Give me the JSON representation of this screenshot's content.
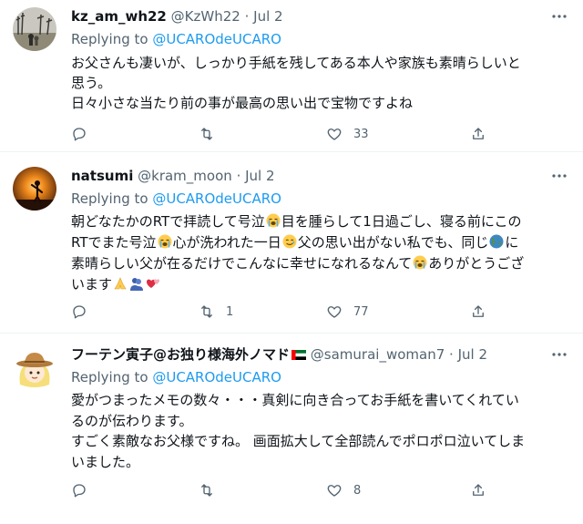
{
  "tweets": [
    {
      "name": "kz_am_wh22",
      "handle": "@KzWh22",
      "dot": "·",
      "date": "Jul 2",
      "replying_prefix": "Replying to ",
      "replying_to": "@UCAROdeUCARO",
      "lines": [
        "お父さんも凄いが、しっかり手紙を残してある本人や家族も素晴らしいと",
        "思う。",
        "日々小さな当たり前の事が最高の思い出で宝物ですよね"
      ],
      "replies": "",
      "retweets": "",
      "likes": "33",
      "avatar": "photo-trees-park"
    },
    {
      "name": "natsumi",
      "handle": "@kram_moon",
      "dot": "·",
      "date": "Jul 2",
      "replying_prefix": "Replying to ",
      "replying_to": "@UCAROdeUCARO",
      "segments": {
        "l1a": "朝どなたかのRTで拝読して号泣",
        "l1b": "目を腫らして1日過ごし、寝る前にこの",
        "l2a": "RTでまた号泣",
        "l2b": "心が洗われた一日",
        "l2c": "父の思い出がない私でも、同じ",
        "l2d": "に",
        "l3a": "素晴らしい父が在るだけでこんなに幸せになれるなんて",
        "l3b": "ありがとうござ",
        "l4a": "います"
      },
      "emoji": {
        "crying": "loudly-crying-face",
        "smiling_tear": "smiling-face-with-tear",
        "globe": "globe-icon",
        "pray": "folded-hands",
        "hug": "people-hugging",
        "hearts": "revolving-hearts"
      },
      "replies": "",
      "retweets": "1",
      "likes": "77",
      "avatar": "photo-sunset-silhouette"
    },
    {
      "name": "フーテン寅子@お独り様海外ノマド",
      "handle": "@samurai_woman7",
      "dot": "·",
      "date": "Jul 2",
      "flag": "uae-flag",
      "replying_prefix": "Replying to ",
      "replying_to": "@UCAROdeUCARO",
      "lines": [
        "愛がつまったメモの数々・・・真剣に向き合ってお手紙を書いてくれてい",
        "るのが伝わります。",
        "すごく素敵なお父様ですね。 画面拡大して全部読んでポロポロ泣いてしま",
        "いました。"
      ],
      "replies": "",
      "retweets": "",
      "likes": "8",
      "avatar": "cartoon-girl-cowboy-hat"
    }
  ],
  "colors": {
    "text": "#0f1419",
    "muted": "#536471",
    "link": "#1d9bf0",
    "divider": "#eff3f4"
  }
}
